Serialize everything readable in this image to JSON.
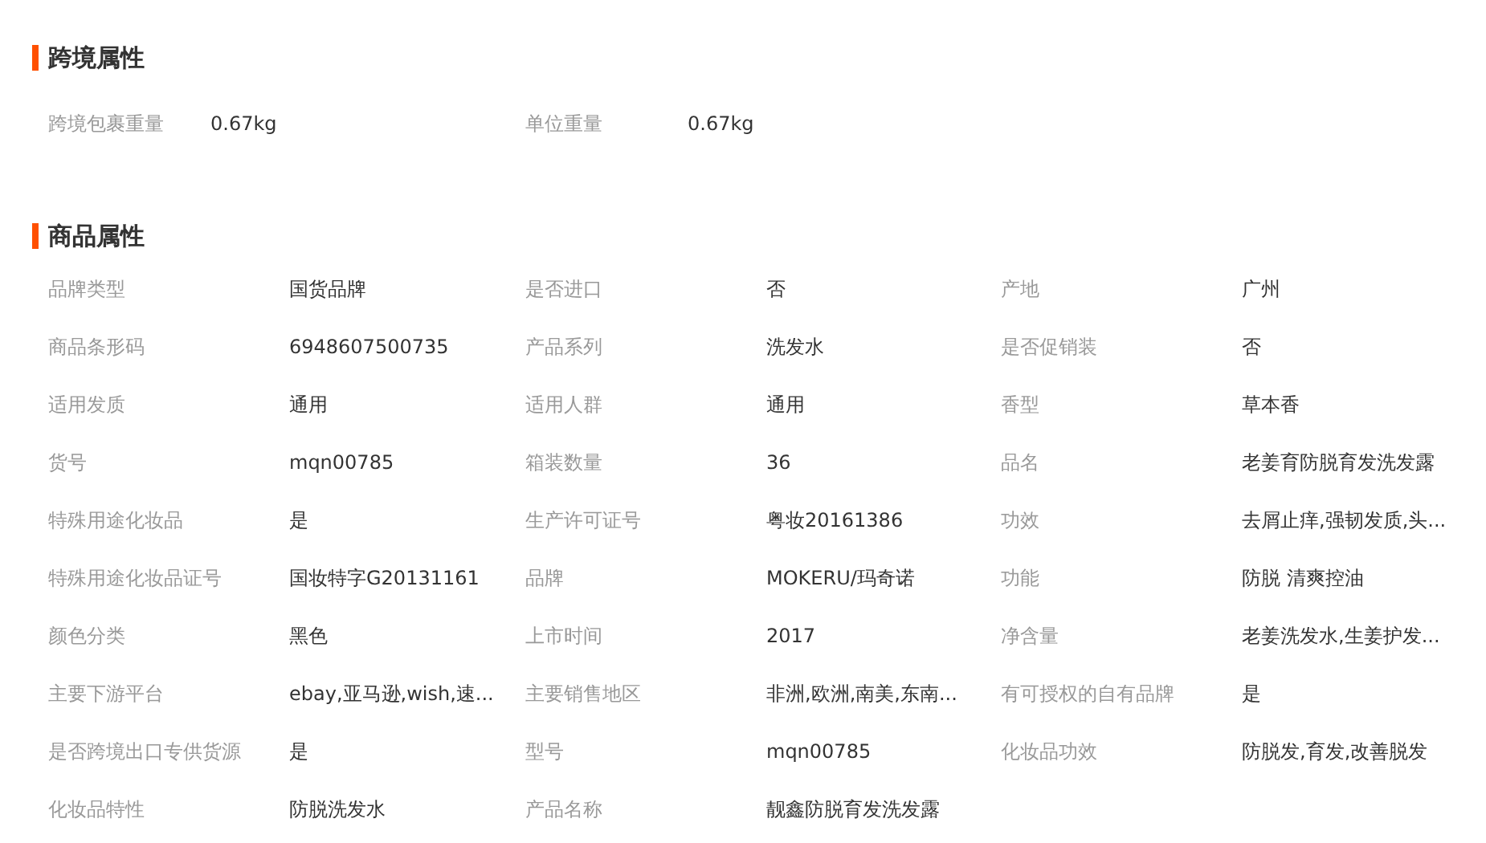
{
  "sections": [
    {
      "title": "跨境属性",
      "kind": "wide",
      "attributes": [
        {
          "label": "跨境包裹重量",
          "value": "0.67kg"
        },
        {
          "label": "单位重量",
          "value": "0.67kg"
        }
      ]
    },
    {
      "title": "商品属性",
      "kind": "grid",
      "attributes": [
        {
          "label": "品牌类型",
          "value": "国货品牌"
        },
        {
          "label": "是否进口",
          "value": "否"
        },
        {
          "label": "产地",
          "value": "广州"
        },
        {
          "label": "商品条形码",
          "value": "6948607500735"
        },
        {
          "label": "产品系列",
          "value": "洗发水"
        },
        {
          "label": "是否促销装",
          "value": "否"
        },
        {
          "label": "适用发质",
          "value": "通用"
        },
        {
          "label": "适用人群",
          "value": "通用"
        },
        {
          "label": "香型",
          "value": "草本香"
        },
        {
          "label": "货号",
          "value": "mqn00785"
        },
        {
          "label": "箱装数量",
          "value": "36"
        },
        {
          "label": "品名",
          "value": "老姜育防脱育发洗发露"
        },
        {
          "label": "特殊用途化妆品",
          "value": "是"
        },
        {
          "label": "生产许可证号",
          "value": "粤妆20161386"
        },
        {
          "label": "功效",
          "value": "去屑止痒,强韧发质,头..."
        },
        {
          "label": "特殊用途化妆品证号",
          "value": "国妆特字G20131161"
        },
        {
          "label": "品牌",
          "value": "MOKERU/玛奇诺"
        },
        {
          "label": "功能",
          "value": "防脱 清爽控油"
        },
        {
          "label": "颜色分类",
          "value": "黑色"
        },
        {
          "label": "上市时间",
          "value": "2017"
        },
        {
          "label": "净含量",
          "value": "老姜洗发水,生姜护发..."
        },
        {
          "label": "主要下游平台",
          "value": "ebay,亚马逊,wish,速..."
        },
        {
          "label": "主要销售地区",
          "value": "非洲,欧洲,南美,东南..."
        },
        {
          "label": "有可授权的自有品牌",
          "value": "是"
        },
        {
          "label": "是否跨境出口专供货源",
          "value": "是"
        },
        {
          "label": "型号",
          "value": "mqn00785"
        },
        {
          "label": "化妆品功效",
          "value": "防脱发,育发,改善脱发"
        },
        {
          "label": "化妆品特性",
          "value": "防脱洗发水"
        },
        {
          "label": "产品名称",
          "value": "靓鑫防脱育发洗发露"
        }
      ]
    }
  ]
}
